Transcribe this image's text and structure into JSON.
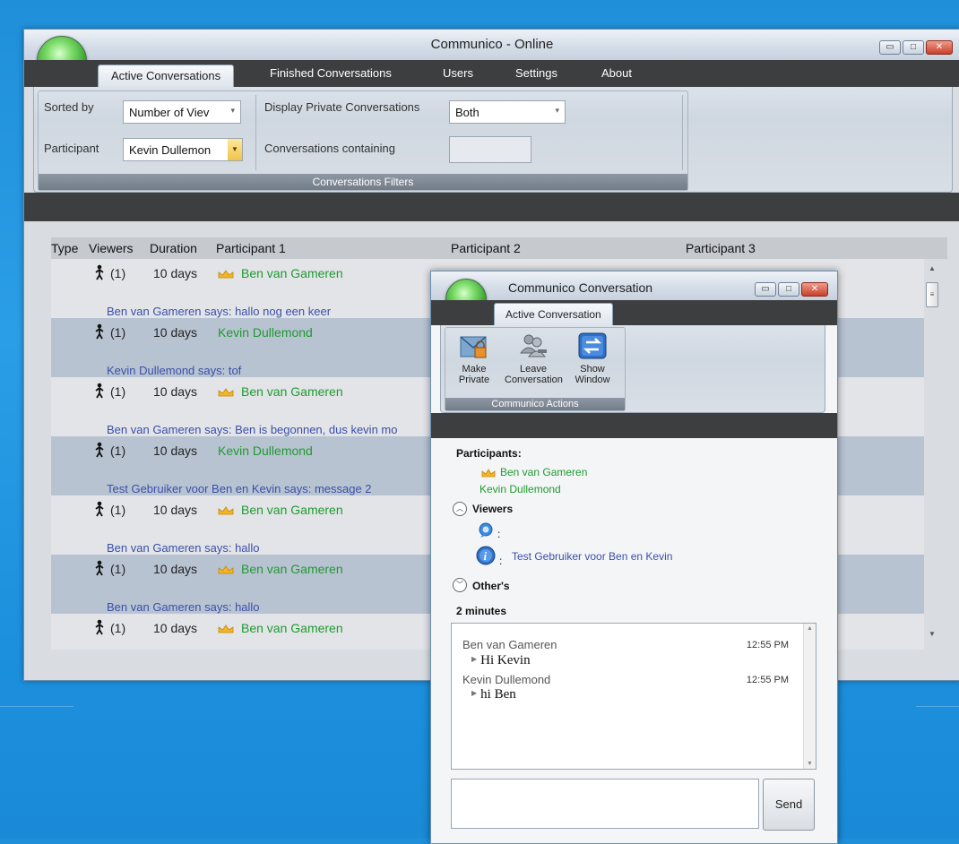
{
  "main_window": {
    "title": "Communico -  Online",
    "tabs": [
      "Active Conversations",
      "Finished Conversations",
      "Users",
      "Settings",
      "About"
    ],
    "active_tab": "Active Conversations"
  },
  "filters": {
    "sorted_by_label": "Sorted by",
    "sorted_by_value": "Number of Viev",
    "participant_label": "Participant",
    "participant_value": "Kevin Dullemon",
    "display_private_label": "Display Private Conversations",
    "display_private_value": "Both",
    "containing_label": "Conversations containing",
    "containing_value": "",
    "group_caption": "Conversations Filters"
  },
  "grid": {
    "columns": [
      "Type",
      "Viewers",
      "Duration",
      "Participant 1",
      "Participant 2",
      "Participant 3"
    ],
    "rows": [
      {
        "viewers": "(1)",
        "duration": "10 days",
        "crown": true,
        "participant1": "Ben van Gameren",
        "message": "Ben van Gameren says: hallo nog een keer"
      },
      {
        "viewers": "(1)",
        "duration": "10 days",
        "crown": false,
        "participant1": "Kevin Dullemond",
        "message": "Kevin Dullemond says: tof"
      },
      {
        "viewers": "(1)",
        "duration": "10 days",
        "crown": true,
        "participant1": "Ben van Gameren",
        "message": "Ben van Gameren says: Ben is begonnen, dus kevin mo"
      },
      {
        "viewers": "(1)",
        "duration": "10 days",
        "crown": false,
        "participant1": "Kevin Dullemond",
        "message": "Test Gebruiker voor Ben en Kevin says: message 2"
      },
      {
        "viewers": "(1)",
        "duration": "10 days",
        "crown": true,
        "participant1": "Ben van Gameren",
        "message": "Ben van Gameren says: hallo"
      },
      {
        "viewers": "(1)",
        "duration": "10 days",
        "crown": true,
        "participant1": "Ben van Gameren",
        "message": "Ben van Gameren says: hallo"
      },
      {
        "viewers": "(1)",
        "duration": "10 days",
        "crown": true,
        "participant1": "Ben van Gameren",
        "message": ""
      }
    ]
  },
  "conversation_window": {
    "title": "Communico Conversation",
    "tab": "Active Conversation",
    "actions": [
      {
        "line1": "Make",
        "line2": "Private",
        "icon": "envelope-lock-icon"
      },
      {
        "line1": "Leave",
        "line2": "Conversation",
        "icon": "users-remove-icon"
      },
      {
        "line1": "Show",
        "line2": "Window",
        "icon": "swap-window-icon"
      }
    ],
    "actions_caption": "Communico Actions",
    "participants_label": "Participants:",
    "participants": [
      "Ben van Gameren",
      "Kevin Dullemond"
    ],
    "viewers_label": "Viewers",
    "viewer_rows": [
      {
        "icon": "chat-bubble-icon",
        "colon": ":",
        "name": ""
      },
      {
        "icon": "info-icon",
        "colon": ":",
        "name": "Test Gebruiker voor Ben en Kevin"
      }
    ],
    "others_label": "Other's",
    "duration_label": "2 minutes",
    "messages": [
      {
        "sender": "Ben van Gameren",
        "time": "12:55 PM",
        "text": "Hi Kevin"
      },
      {
        "sender": "Kevin Dullemond",
        "time": "12:55 PM",
        "text": "hi Ben"
      }
    ],
    "input_value": "",
    "send_label": "Send"
  },
  "colors": {
    "participant_green": "#1f9a2f",
    "message_blue": "#3a4fa8",
    "dark_band": "#3d3e40",
    "desktop_blue": "#2196df"
  }
}
